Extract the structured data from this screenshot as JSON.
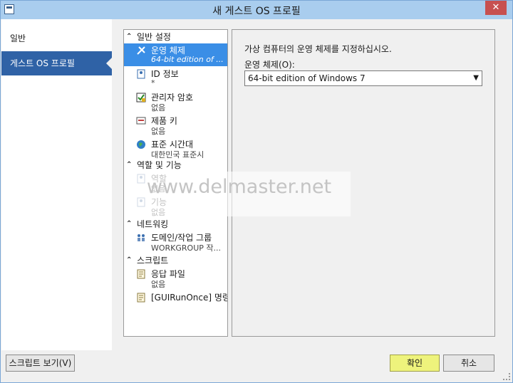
{
  "window": {
    "title": "새 게스트 OS 프로필",
    "close": "✕"
  },
  "nav": {
    "items": [
      "일반",
      "게스트 OS 프로필"
    ]
  },
  "tree": {
    "sections": {
      "general": "일반 설정",
      "roles": "역할 및 기능",
      "network": "네트워킹",
      "scripts": "스크립트"
    },
    "items": {
      "os": {
        "name": "운영 체제",
        "value": "64-bit edition of ..."
      },
      "identity": {
        "name": "ID 정보",
        "value": "*"
      },
      "admin_password": {
        "name": "관리자 암호",
        "value": "없음"
      },
      "product_key": {
        "name": "제품 키",
        "value": "없음"
      },
      "timezone": {
        "name": "표준 시간대",
        "value": "대한민국 표준시"
      },
      "roles": {
        "name": "역할",
        "value": "없음"
      },
      "features": {
        "name": "기능",
        "value": "없음"
      },
      "domain": {
        "name": "도메인/작업 그룹",
        "value": "WORKGROUP 작..."
      },
      "answer_file": {
        "name": "응답 파일",
        "value": "없음"
      },
      "guirunonce": {
        "name": "[GUIRunOnce] 명령"
      }
    }
  },
  "content": {
    "description": "가상 컴퓨터의 운영 체제를 지정하십시오.",
    "os_label": "운영 체제(O):",
    "os_value": "64-bit edition of Windows 7"
  },
  "watermark": "www.delmaster.net",
  "buttons": {
    "view_script": "스크립트 보기(V)",
    "ok": "확인",
    "cancel": "취소"
  },
  "colors": {
    "titlebar": "#a9cdee",
    "nav_selected": "#2f62a6",
    "tree_selected": "#3a8ee6",
    "ok_button": "#eef37c"
  }
}
